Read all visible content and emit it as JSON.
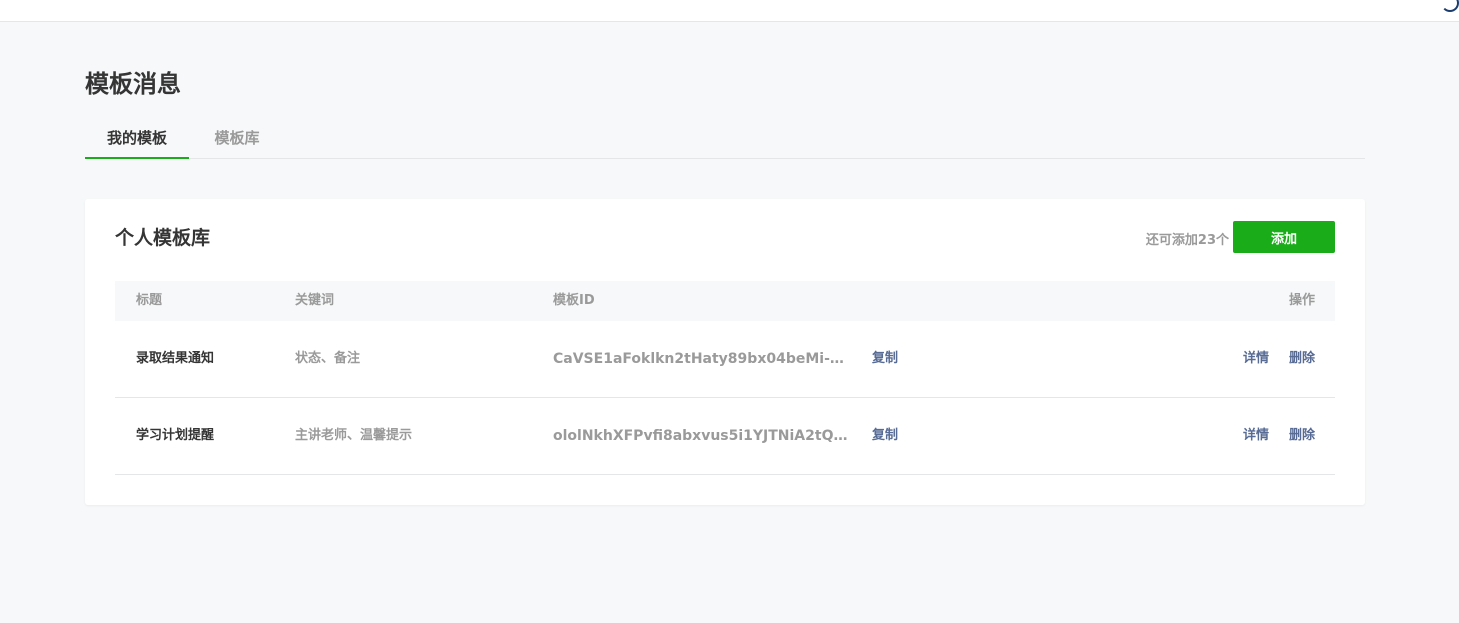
{
  "page": {
    "title": "模板消息"
  },
  "tabs": [
    {
      "label": "我的模板",
      "active": true
    },
    {
      "label": "模板库",
      "active": false
    }
  ],
  "card": {
    "title": "个人模板库",
    "remain_text": "还可添加23个",
    "add_label": "添加"
  },
  "table": {
    "headers": {
      "title": "标题",
      "keywords": "关键词",
      "template_id": "模板ID",
      "actions": "操作"
    },
    "rows": [
      {
        "title": "录取结果通知",
        "keywords": "状态、备注",
        "template_id": "CaVSE1aFoklkn2tHaty89bx04beMi-o…",
        "copy_label": "复制",
        "detail_label": "详情",
        "delete_label": "删除"
      },
      {
        "title": "学习计划提醒",
        "keywords": "主讲老师、温馨提示",
        "template_id": "ololNkhXFPvfi8abxvus5i1YJTNiA2tQr…",
        "copy_label": "复制",
        "detail_label": "详情",
        "delete_label": "删除"
      }
    ]
  },
  "colors": {
    "accent": "#1aad19",
    "link": "#576b95",
    "background": "#f6f8f9"
  },
  "icons": {
    "topbar": "corner-icon"
  }
}
